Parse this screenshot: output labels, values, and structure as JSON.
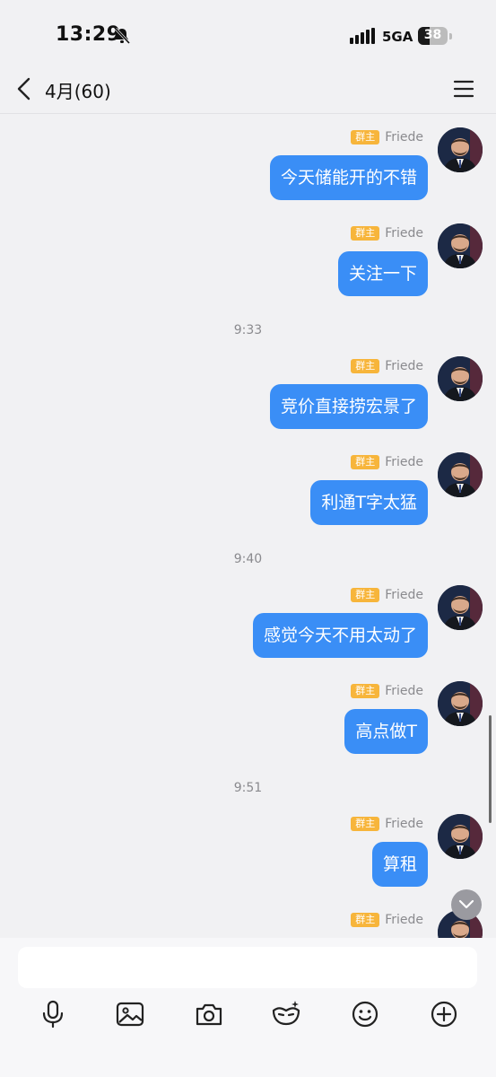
{
  "status_bar": {
    "time": "13:29",
    "network": "5GA",
    "battery": "38"
  },
  "header": {
    "title": "4月(60)"
  },
  "messages": [
    {
      "badge": "群主",
      "sender": "Friede",
      "text": "今天储能开的不错"
    },
    {
      "badge": "群主",
      "sender": "Friede",
      "text": "关注一下"
    },
    {
      "badge": "群主",
      "sender": "Friede",
      "text": "竞价直接捞宏景了"
    },
    {
      "badge": "群主",
      "sender": "Friede",
      "text": "利通T字太猛"
    },
    {
      "badge": "群主",
      "sender": "Friede",
      "text": "感觉今天不用太动了"
    },
    {
      "badge": "群主",
      "sender": "Friede",
      "text": "高点做T"
    },
    {
      "badge": "群主",
      "sender": "Friede",
      "text": "算租"
    },
    {
      "badge": "群主",
      "sender": "Friede",
      "text": ""
    }
  ],
  "timestamps": [
    "9:33",
    "9:40",
    "9:51"
  ],
  "input": {
    "value": "",
    "placeholder": ""
  },
  "toolbar_icons": [
    "microphone-icon",
    "image-icon",
    "camera-icon",
    "mask-sparkle-icon",
    "emoji-icon",
    "plus-icon"
  ],
  "colors": {
    "bubble": "#3a8ef6",
    "badge": "#f7b53b",
    "background": "#f1f1f3"
  }
}
